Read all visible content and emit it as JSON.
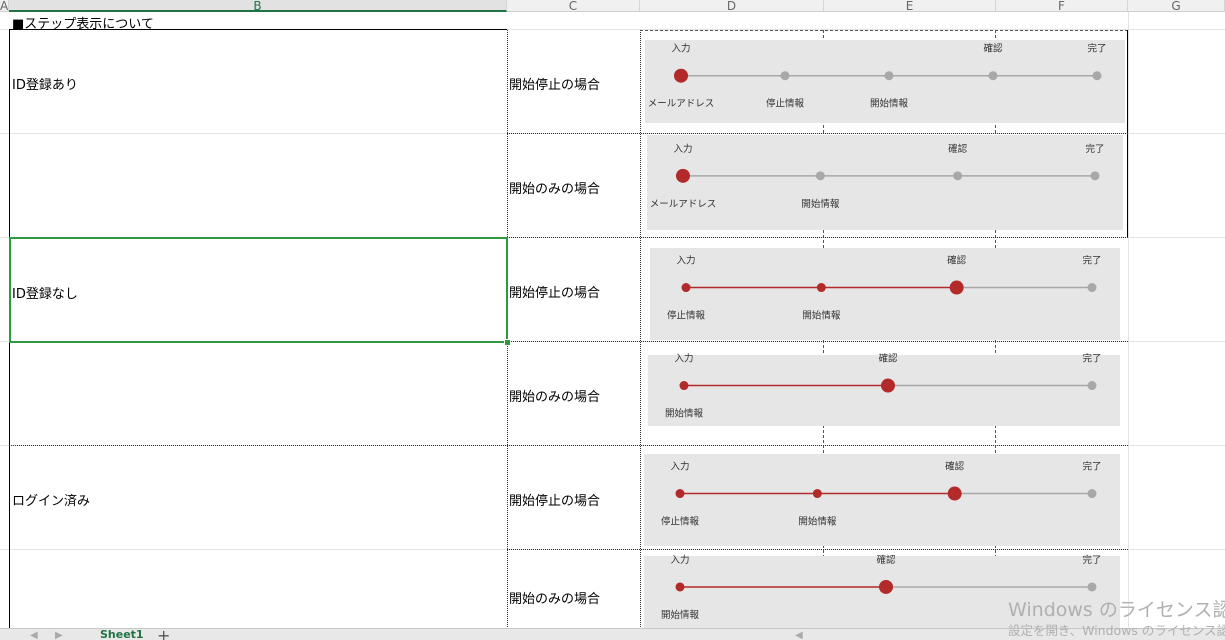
{
  "columns": [
    "A",
    "B",
    "C",
    "D",
    "E",
    "F",
    "G"
  ],
  "selected_column": "B",
  "title_cell": "■ステップ表示について",
  "rows": [
    {
      "group": "ID登録あり",
      "case": "開始停止の場合"
    },
    {
      "group": "",
      "case": "開始のみの場合"
    },
    {
      "group": "ID登録なし",
      "case": "開始停止の場合"
    },
    {
      "group": "",
      "case": "開始のみの場合"
    },
    {
      "group": "ログイン済み",
      "case": "開始停止の場合"
    },
    {
      "group": "",
      "case": "開始のみの場合"
    }
  ],
  "step_indicators": [
    {
      "current": 0,
      "steps": [
        {
          "top": "入力",
          "bottom": "メールアドレス"
        },
        {
          "top": "",
          "bottom": "停止情報"
        },
        {
          "top": "",
          "bottom": "開始情報"
        },
        {
          "top": "確認",
          "bottom": ""
        },
        {
          "top": "完了",
          "bottom": ""
        }
      ]
    },
    {
      "current": 0,
      "steps": [
        {
          "top": "入力",
          "bottom": "メールアドレス"
        },
        {
          "top": "",
          "bottom": "開始情報"
        },
        {
          "top": "確認",
          "bottom": ""
        },
        {
          "top": "完了",
          "bottom": ""
        }
      ]
    },
    {
      "current": 2,
      "steps": [
        {
          "top": "入力",
          "bottom": "停止情報"
        },
        {
          "top": "",
          "bottom": "開始情報"
        },
        {
          "top": "確認",
          "bottom": ""
        },
        {
          "top": "完了",
          "bottom": ""
        }
      ]
    },
    {
      "current": 1,
      "steps": [
        {
          "top": "入力",
          "bottom": "開始情報"
        },
        {
          "top": "確認",
          "bottom": ""
        },
        {
          "top": "完了",
          "bottom": ""
        }
      ]
    },
    {
      "current": 2,
      "steps": [
        {
          "top": "入力",
          "bottom": "停止情報"
        },
        {
          "top": "",
          "bottom": "開始情報"
        },
        {
          "top": "確認",
          "bottom": ""
        },
        {
          "top": "完了",
          "bottom": ""
        }
      ]
    },
    {
      "current": 1,
      "steps": [
        {
          "top": "入力",
          "bottom": "開始情報"
        },
        {
          "top": "確認",
          "bottom": ""
        },
        {
          "top": "完了",
          "bottom": ""
        }
      ]
    }
  ],
  "colors": {
    "active": "#b22a2a",
    "inactive": "#a8a8a8",
    "panel_bg": "#e6e6e6",
    "selection": "#2e9a3e",
    "sheet_tab": "#217346"
  },
  "sheet_tabs": [
    {
      "label": "Sheet1",
      "active": true
    }
  ],
  "watermark": {
    "line1": "Windows のライセンス認証",
    "line2": "設定を開き、Windows のライセンス認"
  }
}
